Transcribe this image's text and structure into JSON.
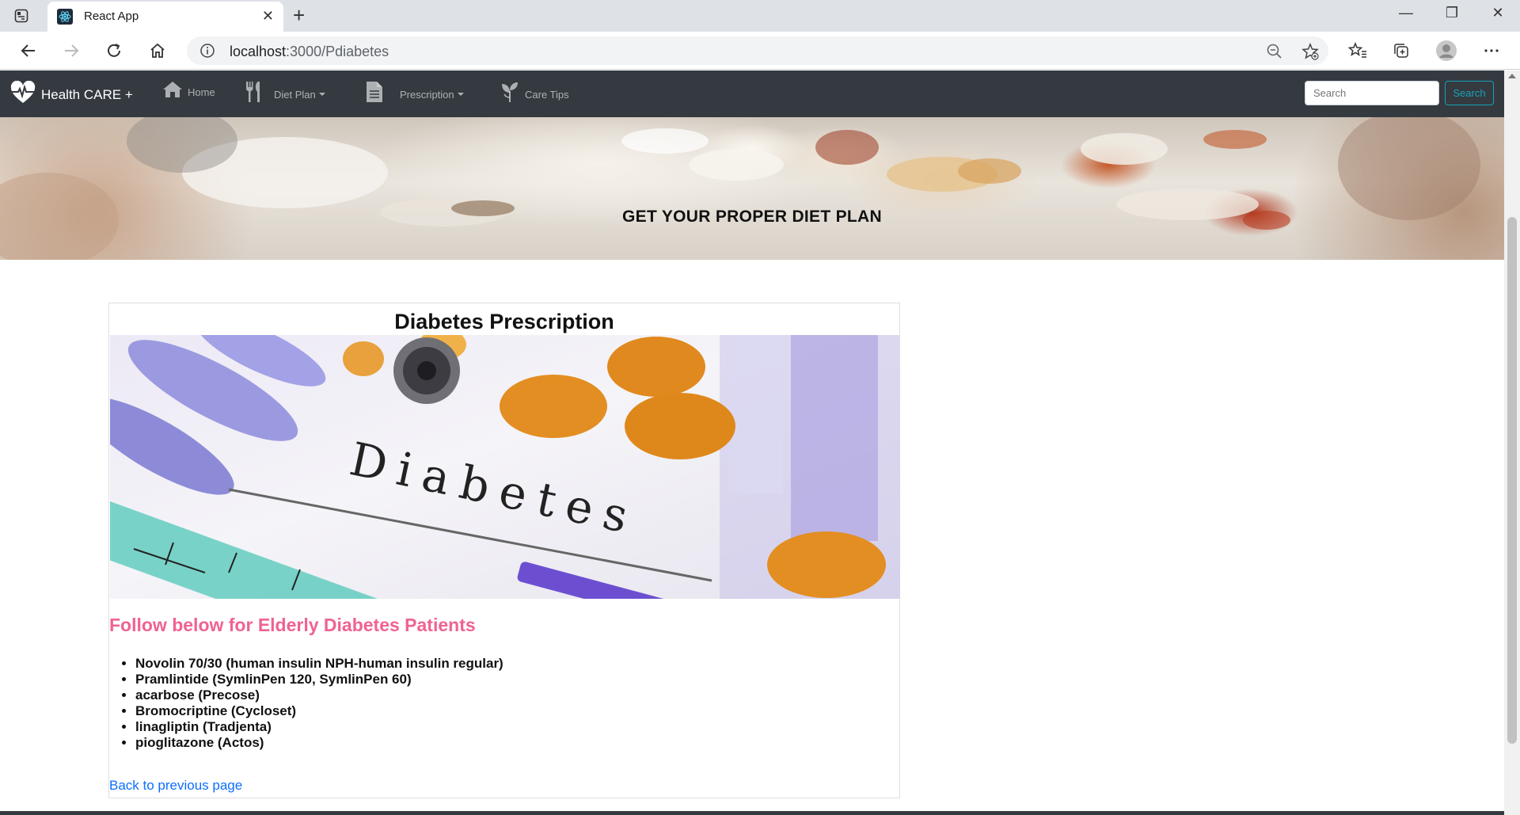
{
  "browser": {
    "tab_title": "React App",
    "url_host": "localhost",
    "url_path": ":3000/Pdiabetes"
  },
  "navbar": {
    "brand": "Health CARE +",
    "items": [
      {
        "label": "Home",
        "icon": "home-icon"
      },
      {
        "label": "Diet Plan",
        "icon": "utensils-icon",
        "dropdown": true
      },
      {
        "label": "Prescription",
        "icon": "file-icon",
        "dropdown": true
      },
      {
        "label": "Care Tips",
        "icon": "seedling-icon"
      }
    ],
    "search_placeholder": "Search",
    "search_button": "Search"
  },
  "hero": {
    "title": "GET YOUR PROPER DIET PLAN"
  },
  "card": {
    "title": "Diabetes Prescription",
    "image_text": "Diabetes",
    "subtitle": "Follow below for Elderly Diabetes Patients",
    "medications": [
      "Novolin 70/30 (human insulin NPH-human insulin regular)",
      "Pramlintide (SymlinPen 120, SymlinPen 60)",
      "acarbose (Precose)",
      "Bromocriptine (Cycloset)",
      "linagliptin (Tradjenta)",
      "pioglitazone (Actos)"
    ],
    "back_link": "Back to previous page"
  },
  "colors": {
    "navbar_bg": "#343a40",
    "subtitle": "#f06292",
    "link": "#0d6efd",
    "search_btn": "#17a2b8"
  }
}
